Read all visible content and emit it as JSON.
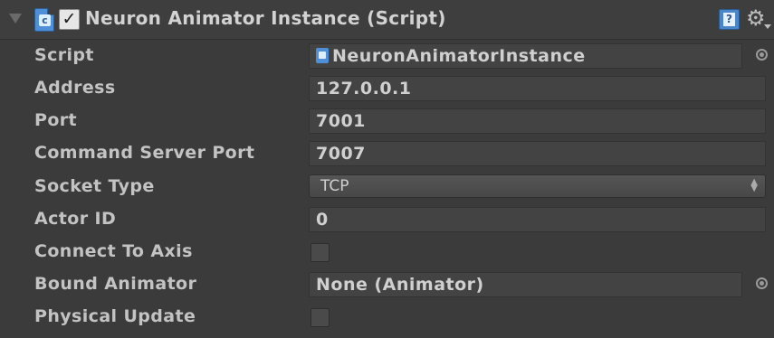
{
  "component": {
    "title": "Neuron Animator Instance (Script)",
    "enabled": true,
    "icons": {
      "foldout": "triangle-down-icon",
      "script": "cs-script-icon",
      "help": "help-book-icon",
      "settings": "gear-icon"
    }
  },
  "fields": {
    "script": {
      "label": "Script",
      "value": "NeuronAnimatorInstance"
    },
    "address": {
      "label": "Address",
      "value": "127.0.0.1"
    },
    "port": {
      "label": "Port",
      "value": "7001"
    },
    "command_server_port": {
      "label": "Command Server Port",
      "value": "7007"
    },
    "socket_type": {
      "label": "Socket Type",
      "value": "TCP"
    },
    "actor_id": {
      "label": "Actor ID",
      "value": "0"
    },
    "connect_to_axis": {
      "label": "Connect To Axis",
      "checked": false
    },
    "bound_animator": {
      "label": "Bound Animator",
      "value": "None (Animator)"
    },
    "physical_update": {
      "label": "Physical Update",
      "checked": false
    }
  },
  "colors": {
    "background": "#3b3b3b",
    "field": "#434343",
    "text": "#c3c3c3",
    "accent": "#4e8fd8"
  }
}
